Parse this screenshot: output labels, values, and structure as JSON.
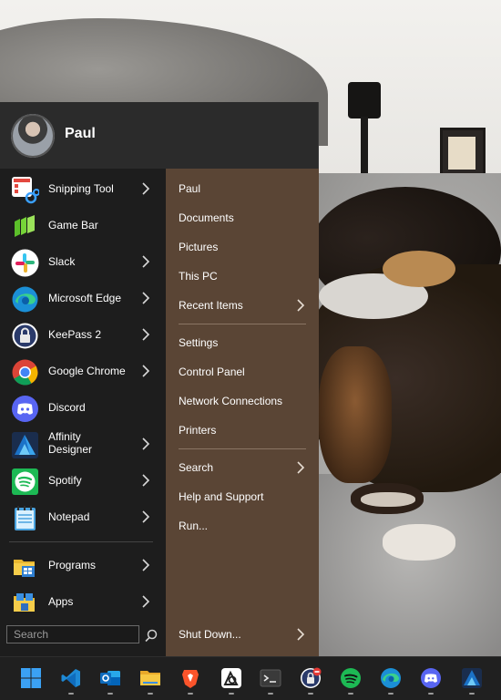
{
  "user": {
    "name": "Paul"
  },
  "apps": [
    {
      "label": "Snipping Tool",
      "icon": "snipping-tool-icon",
      "has_submenu": true
    },
    {
      "label": "Game Bar",
      "icon": "game-bar-icon",
      "has_submenu": false
    },
    {
      "label": "Slack",
      "icon": "slack-icon",
      "has_submenu": true
    },
    {
      "label": "Microsoft Edge",
      "icon": "edge-icon",
      "has_submenu": true
    },
    {
      "label": "KeePass 2",
      "icon": "keepass-icon",
      "has_submenu": true
    },
    {
      "label": "Google Chrome",
      "icon": "chrome-icon",
      "has_submenu": true
    },
    {
      "label": "Discord",
      "icon": "discord-icon",
      "has_submenu": false
    },
    {
      "label": "Affinity Designer",
      "icon": "affinity-designer-icon",
      "has_submenu": true
    },
    {
      "label": "Spotify",
      "icon": "spotify-icon",
      "has_submenu": true
    },
    {
      "label": "Notepad",
      "icon": "notepad-icon",
      "has_submenu": true
    }
  ],
  "bottom_items": [
    {
      "label": "Programs",
      "icon": "programs-folder-icon",
      "has_submenu": true
    },
    {
      "label": "Apps",
      "icon": "apps-folder-icon",
      "has_submenu": true
    }
  ],
  "search": {
    "placeholder": "Search"
  },
  "places": {
    "group1": [
      "Paul",
      "Documents",
      "Pictures",
      "This PC",
      "Recent Items"
    ],
    "group2": [
      "Settings",
      "Control Panel",
      "Network Connections",
      "Printers"
    ],
    "group3": [
      "Search",
      "Help and Support",
      "Run..."
    ],
    "shutdown": "Shut Down..."
  },
  "taskbar": [
    {
      "icon": "start-icon",
      "running": false
    },
    {
      "icon": "vscode-icon",
      "running": true
    },
    {
      "icon": "outlook-icon",
      "running": true
    },
    {
      "icon": "file-explorer-icon",
      "running": true
    },
    {
      "icon": "brave-icon",
      "running": true
    },
    {
      "icon": "affinity-photo-icon",
      "running": true
    },
    {
      "icon": "terminal-icon",
      "running": true
    },
    {
      "icon": "keepass-icon",
      "running": true
    },
    {
      "icon": "spotify-icon",
      "running": true
    },
    {
      "icon": "edge-icon",
      "running": true
    },
    {
      "icon": "discord-icon",
      "running": true
    },
    {
      "icon": "affinity-designer-icon",
      "running": true
    }
  ],
  "colors": {
    "menu_left": "#1d1d1d",
    "menu_right": "#5a4535",
    "menu_header": "#2b2b2b",
    "taskbar": "#202020"
  }
}
